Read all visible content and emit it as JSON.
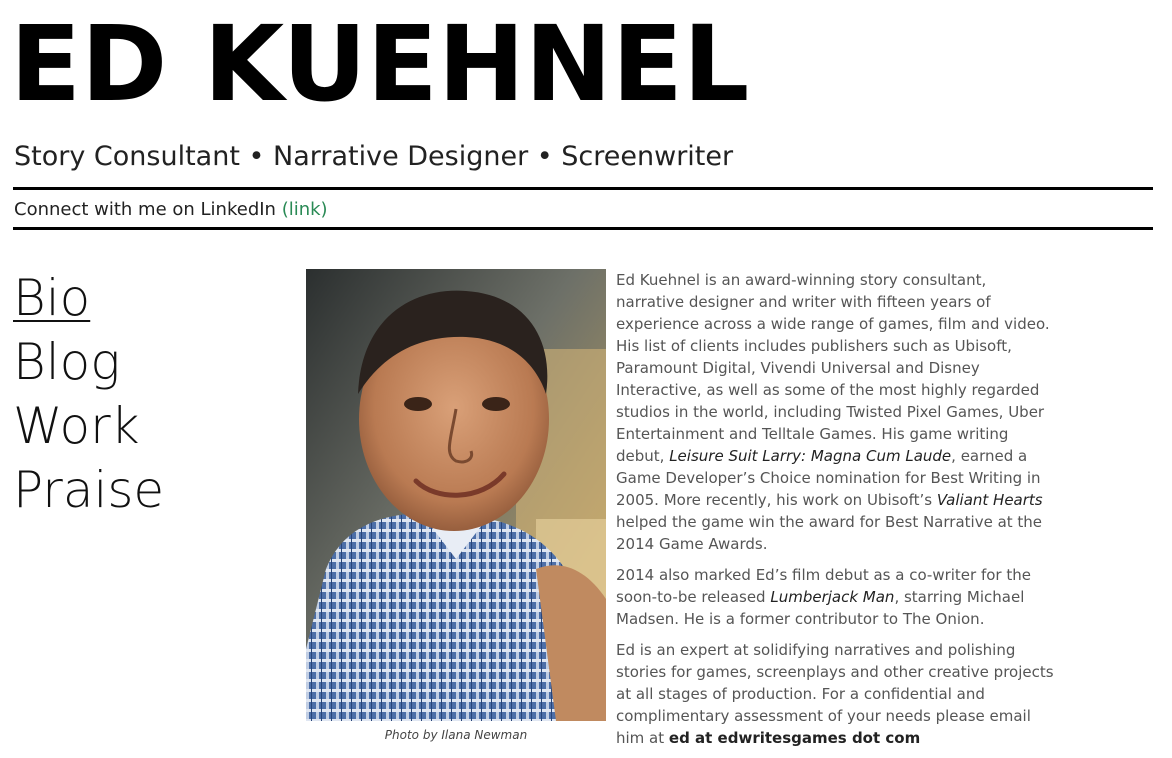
{
  "header": {
    "title": "ED KUEHNEL",
    "subtitle": "Story Consultant • Narrative Designer • Screenwriter"
  },
  "connect": {
    "text": "Connect with me on LinkedIn ",
    "link_label": "(link)"
  },
  "nav": {
    "items": [
      {
        "label": "Bio",
        "active": true
      },
      {
        "label": "Blog",
        "active": false
      },
      {
        "label": "Work",
        "active": false
      },
      {
        "label": "Praise",
        "active": false
      }
    ]
  },
  "photo": {
    "caption": "Photo by Ilana Newman"
  },
  "bio": {
    "p1": {
      "t1": "Ed Kuehnel is an award-winning story consultant, narrative designer and writer with fifteen years of experience across a wide range of games, film and video. His list of clients includes publishers such as Ubisoft, Paramount Digital, Vivendi Universal and Disney Interactive, as well as some of the most highly regarded studios in the world, including Twisted Pixel Games, Uber Entertainment and Telltale Games. His game writing debut, ",
      "em1": "Leisure Suit Larry: Magna Cum Laude",
      "t2": ", earned a Game Developer’s Choice nomination for Best Writing in 2005. More recently, his work on Ubisoft’s ",
      "em2": "Valiant Hearts",
      "t3": " helped the game win the award for Best Narrative at the 2014 Game Awards."
    },
    "p2": {
      "t1": "2014 also marked Ed’s film debut as a co-writer for the soon-to-be released ",
      "em1": "Lumberjack Man",
      "t2": ", starring Michael Madsen. He is a former contributor to The Onion."
    },
    "p3": {
      "t1": "Ed is an expert at solidifying narratives and polishing stories for games, screenplays and other creative projects at all stages of production. For a confidential and complimentary assessment of your needs please email him at ",
      "strong1": "ed at edwritesgames dot com"
    }
  }
}
